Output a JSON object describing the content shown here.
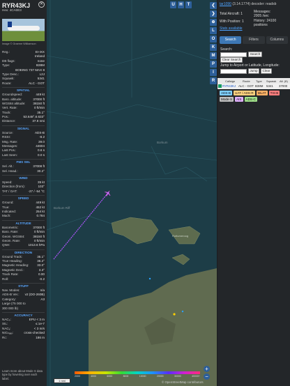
{
  "left": {
    "callsign": "RYR43KJ",
    "hex": "Hex: 4CA0E3",
    "photo_credit": "Image © Graeme Williamson",
    "info_rows": [
      {
        "k": "Reg.:",
        "v": "EI-IXX"
      },
      {
        "k": "",
        "v": "Ireland"
      },
      {
        "k": "DB flags:",
        "v": "none"
      },
      {
        "k": "Type:",
        "v": "B38M"
      },
      {
        "k": "",
        "v": "BOEING 737 MAX 8"
      },
      {
        "k": "Type Desc.:",
        "v": "L2J"
      },
      {
        "k": "Squawk:",
        "v": "5341"
      },
      {
        "k": "Route:",
        "v": "ALC - GOT"
      }
    ],
    "sections": [
      {
        "title": "SPATIAL",
        "rows": [
          {
            "k": "Groundspeed:",
            "v": "449 kt"
          },
          {
            "k": "Baro. altitude:",
            "v": "37000 ft"
          },
          {
            "k": "WGS84 altitude:",
            "v": "38150 ft"
          },
          {
            "k": "Vert. Rate:",
            "v": "0 ft/min"
          },
          {
            "k": "Track:",
            "v": "35.1°"
          },
          {
            "k": "Pos.:",
            "v": "53.648°,6.633°"
          },
          {
            "k": "Distance:",
            "v": "37.8 nmi"
          }
        ]
      },
      {
        "title": "SIGNAL",
        "rows": [
          {
            "k": "Source:",
            "v": "ADS-B"
          },
          {
            "k": "RSSI:",
            "v": "-8.2"
          },
          {
            "k": "Msg. Rate:",
            "v": "39.0"
          },
          {
            "k": "Messages:",
            "v": "44604"
          },
          {
            "k": "Last Pos.:",
            "v": "0.6 s"
          },
          {
            "k": "Last Seen:",
            "v": "0.0 s"
          }
        ]
      },
      {
        "title": "FMS SEL",
        "rows": [
          {
            "k": "Sel. Alt.:",
            "v": "37008 ft"
          },
          {
            "k": "Sel. Head.:",
            "v": "30.2°"
          }
        ]
      },
      {
        "title": "WIND",
        "rows": [
          {
            "k": "Speed:",
            "v": "35 kt"
          },
          {
            "k": "Direction (from):",
            "v": "103°"
          },
          {
            "k": "TAT / OAT:",
            "v": "-27 / -54 °C"
          }
        ]
      },
      {
        "title": "SPEED",
        "rows": [
          {
            "k": "Ground:",
            "v": "449 kt"
          },
          {
            "k": "True:",
            "v": "452 kt"
          },
          {
            "k": "Indicated:",
            "v": "254 kt"
          },
          {
            "k": "Mach:",
            "v": "0.784"
          }
        ]
      },
      {
        "title": "ALTITUDE",
        "rows": [
          {
            "k": "Barometric:",
            "v": "37000 ft"
          },
          {
            "k": "Baro. Rate:",
            "v": "0 ft/min"
          },
          {
            "k": "Geom. WGS84:",
            "v": "38150 ft"
          },
          {
            "k": "Geom. Rate:",
            "v": "0 ft/min"
          },
          {
            "k": "QNH:",
            "v": "1013.6 hPa"
          }
        ]
      },
      {
        "title": "DIRECTION",
        "rows": [
          {
            "k": "Ground Track:",
            "v": "35.1°"
          },
          {
            "k": "True Heading:",
            "v": "36.2°"
          },
          {
            "k": "Magnetic Heading:",
            "v": "33.0°"
          },
          {
            "k": "Magnetic Decl.:",
            "v": "3.3°"
          },
          {
            "k": "Track Rate:",
            "v": "0.00"
          },
          {
            "k": "Roll:",
            "v": "-0.2"
          }
        ]
      },
      {
        "title": "STUFF",
        "rows": [
          {
            "k": "Nav. Modes:",
            "v": "n/a"
          },
          {
            "k": "ADS-B Ver.:",
            "v": "v2 (DO-260B)"
          },
          {
            "k": "Category:",
            "v": "A3"
          },
          {
            "k": "Large (75 000 to",
            "v": ""
          },
          {
            "k": "300 000 lb)",
            "v": ""
          }
        ]
      },
      {
        "title": "ACCURACY",
        "rows": [
          {
            "k": "NACₚ:",
            "v": "EPU < 3 m"
          },
          {
            "k": "SIL:",
            "v": "≤ 1e-7"
          },
          {
            "k": "NACᵥ:",
            "v": "< 3 m/s"
          },
          {
            "k": "NICₕₐₐₒ:",
            "v": "cross-checked"
          },
          {
            "k": "Rᴄ:",
            "v": "186 m"
          }
        ]
      }
    ],
    "footer": "Learn more about Mode S data type by hovering over each label."
  },
  "map": {
    "top_buttons": [
      "U",
      "H",
      "T"
    ],
    "zoom_in": "+",
    "zoom_out": "−",
    "scale_label": "1 nmi",
    "attribution": "© OpenStreetMap contributors",
    "place_labels": [
      "Borkum",
      "Borkum Riff",
      "Rottumeroog"
    ],
    "colorbar_labels": [
      "2000",
      "4000",
      "6000",
      "8000",
      "10000",
      "20000",
      "30000",
      "40000+"
    ]
  },
  "icons": [
    "❮",
    "❯",
    "⊕",
    "L",
    "O",
    "K",
    "M",
    "P",
    "I",
    "R"
  ],
  "right": {
    "header_link": "tar1090",
    "header_text": "(3.14.1774) decoder: readsb",
    "total_aircraft_label": "Total Aircraft: 1",
    "with_position_label": "With Position: 1",
    "stats_label": "Stats available",
    "messages_label": "Messages:",
    "messages_value": "2005 /sec",
    "history_label": "History: 24100",
    "history_value": "positions",
    "tabs": [
      "Search",
      "Filters",
      "Columns"
    ],
    "search_label": "Search:",
    "search_button": "Search",
    "clear_search_button": "Clear Search",
    "jump_label": "Jump to Airport or Latitude, Longitude:",
    "jump_button": "Jump",
    "clear_button": "Clear",
    "table_headers": [
      "Callsign",
      "Route",
      "Type",
      "Squawk",
      "Alt. (ft)"
    ],
    "table_row": {
      "callsign": "RYR43KJ",
      "route": "ALC - GOT",
      "type": "B38M",
      "squawk": "5341",
      "alt": "37000"
    },
    "legend": [
      {
        "label": "ADS-B",
        "color": "#7fd0ff"
      },
      {
        "label": "UAT / ADS-R",
        "color": "#ffd27f"
      },
      {
        "label": "MLAT",
        "color": "#ffb266"
      },
      {
        "label": "TIS-B",
        "color": "#ff7f7f"
      },
      {
        "label": "Mode-S",
        "color": "#bfbfbf"
      },
      {
        "label": "AIS",
        "color": "#e0b0ff"
      },
      {
        "label": "ADS-C",
        "color": "#a0e08a"
      }
    ]
  }
}
